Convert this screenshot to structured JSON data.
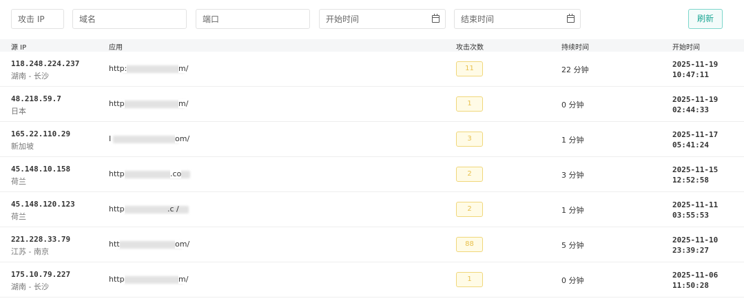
{
  "filters": {
    "ip_placeholder": "攻击 IP",
    "domain_placeholder": "域名",
    "port_placeholder": "端口",
    "start_time_placeholder": "开始时间",
    "end_time_placeholder": "结束时间",
    "refresh_label": "刷新"
  },
  "columns": [
    "源 IP",
    "应用",
    "攻击次数",
    "持续时间",
    "开始时间"
  ],
  "rows": [
    {
      "ip": "118.248.224.237",
      "location": "湖南 - 长沙",
      "app_prefix": "http:",
      "app_suffix": "m/",
      "count": "11",
      "duration": "22 分钟",
      "date": "2025-11-19",
      "time": "10:47:11"
    },
    {
      "ip": "48.218.59.7",
      "location": "日本",
      "app_prefix": "http",
      "app_suffix": "m/",
      "count": "1",
      "duration": "0 分钟",
      "date": "2025-11-19",
      "time": "02:44:33"
    },
    {
      "ip": "165.22.110.29",
      "location": "新加坡",
      "app_prefix": "I",
      "app_suffix": "om/",
      "count": "3",
      "duration": "1 分钟",
      "date": "2025-11-17",
      "time": "05:41:24"
    },
    {
      "ip": "45.148.10.158",
      "location": "荷兰",
      "app_prefix": "http",
      "app_suffix": ".co",
      "count": "2",
      "duration": "3 分钟",
      "date": "2025-11-15",
      "time": "12:52:58"
    },
    {
      "ip": "45.148.120.123",
      "location": "荷兰",
      "app_prefix": "http",
      "app_suffix": ".c  /",
      "count": "2",
      "duration": "1 分钟",
      "date": "2025-11-11",
      "time": "03:55:53"
    },
    {
      "ip": "221.228.33.79",
      "location": "江苏 - 南京",
      "app_prefix": "htt",
      "app_suffix": "om/",
      "count": "88",
      "duration": "5 分钟",
      "date": "2025-11-10",
      "time": "23:39:27"
    },
    {
      "ip": "175.10.79.227",
      "location": "湖南 - 长沙",
      "app_prefix": "http",
      "app_suffix": "m/",
      "count": "1",
      "duration": "0 分钟",
      "date": "2025-11-06",
      "time": "11:50:28"
    }
  ]
}
